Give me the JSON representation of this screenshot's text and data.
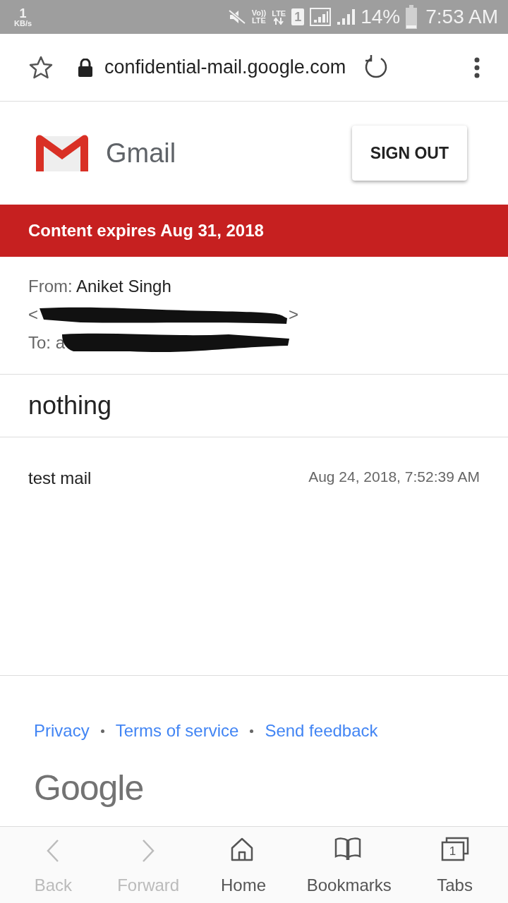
{
  "status_bar": {
    "speed": "1",
    "speed_unit": "KB/s",
    "volte_top": "Vo))",
    "volte_bottom": "LTE",
    "lte": "LTE",
    "sim": "1",
    "battery_text": "14%",
    "battery": {
      "level": 0.14
    },
    "time": "7:53 AM"
  },
  "browser": {
    "url": "confidential-mail.google.com",
    "bookmarked": false
  },
  "header": {
    "brand": "Gmail",
    "sign_out": "SIGN OUT"
  },
  "banner": "Content expires Aug 31, 2018",
  "sender": {
    "from_label": "From:",
    "from_name": "Aniket Singh",
    "from_open": "<",
    "from_close": ">",
    "to_label": "To: a"
  },
  "subject": "nothing",
  "message": {
    "body": "test mail",
    "date": "Aug 24, 2018, 7:52:39 AM"
  },
  "footer": {
    "links": [
      "Privacy",
      "Terms of service",
      "Send feedback"
    ],
    "logo": "Google"
  },
  "nav": [
    {
      "kind": "back",
      "label": "Back",
      "disabled": true
    },
    {
      "kind": "forward",
      "label": "Forward",
      "disabled": true
    },
    {
      "kind": "home",
      "label": "Home",
      "disabled": false
    },
    {
      "kind": "bookmarks",
      "label": "Bookmarks",
      "disabled": false
    },
    {
      "kind": "tabs",
      "label": "Tabs",
      "disabled": false,
      "count": "1"
    }
  ]
}
